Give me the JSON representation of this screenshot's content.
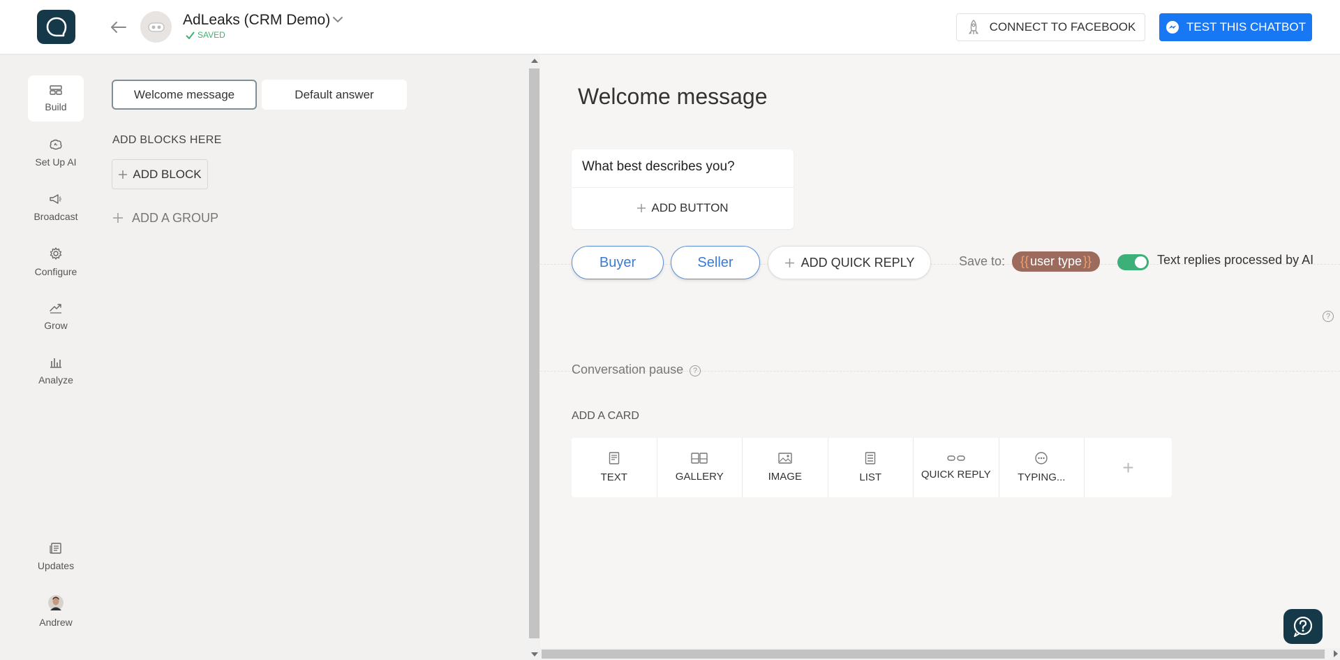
{
  "header": {
    "bot_name": "AdLeaks (CRM Demo)",
    "saved_label": "SAVED",
    "connect_facebook_label": "CONNECT TO FACEBOOK",
    "test_chatbot_label": "TEST THIS CHATBOT"
  },
  "sidebar": {
    "items": [
      {
        "label": "Build",
        "icon": "build-icon"
      },
      {
        "label": "Set Up AI",
        "icon": "ai-brain-icon"
      },
      {
        "label": "Broadcast",
        "icon": "megaphone-icon"
      },
      {
        "label": "Configure",
        "icon": "gear-icon"
      },
      {
        "label": "Grow",
        "icon": "trend-up-icon"
      },
      {
        "label": "Analyze",
        "icon": "bar-chart-icon"
      }
    ],
    "bottom": [
      {
        "label": "Updates",
        "icon": "updates-icon"
      },
      {
        "label": "Andrew",
        "icon": "user-avatar"
      }
    ]
  },
  "blocks": {
    "tabs": [
      "Welcome message",
      "Default answer"
    ],
    "add_blocks_label": "ADD BLOCKS HERE",
    "add_block_button": "ADD BLOCK",
    "add_group_button": "ADD A GROUP"
  },
  "editor": {
    "title": "Welcome message",
    "message_text": "What best describes you?",
    "add_button_label": "ADD BUTTON",
    "quick_replies": [
      "Buyer",
      "Seller"
    ],
    "add_quick_reply_label": "ADD QUICK REPLY",
    "save_to_label": "Save to:",
    "variable_open": "{{",
    "variable_name": "user type",
    "variable_close": "}}",
    "ai_toggle_label": "Text replies processed by AI",
    "help_glyph": "?",
    "conversation_pause_label": "Conversation pause",
    "add_card_label": "ADD A CARD",
    "card_options": [
      "TEXT",
      "GALLERY",
      "IMAGE",
      "LIST",
      "QUICK REPLY",
      "TYPING...",
      "+"
    ]
  },
  "colors": {
    "brand_dark": "#16394a",
    "primary_blue": "#1877f2",
    "quick_reply_blue": "#3d7bd0",
    "variable_brown": "#9c6b5d",
    "toggle_green": "#3db07a",
    "saved_green": "#3cb46e"
  }
}
